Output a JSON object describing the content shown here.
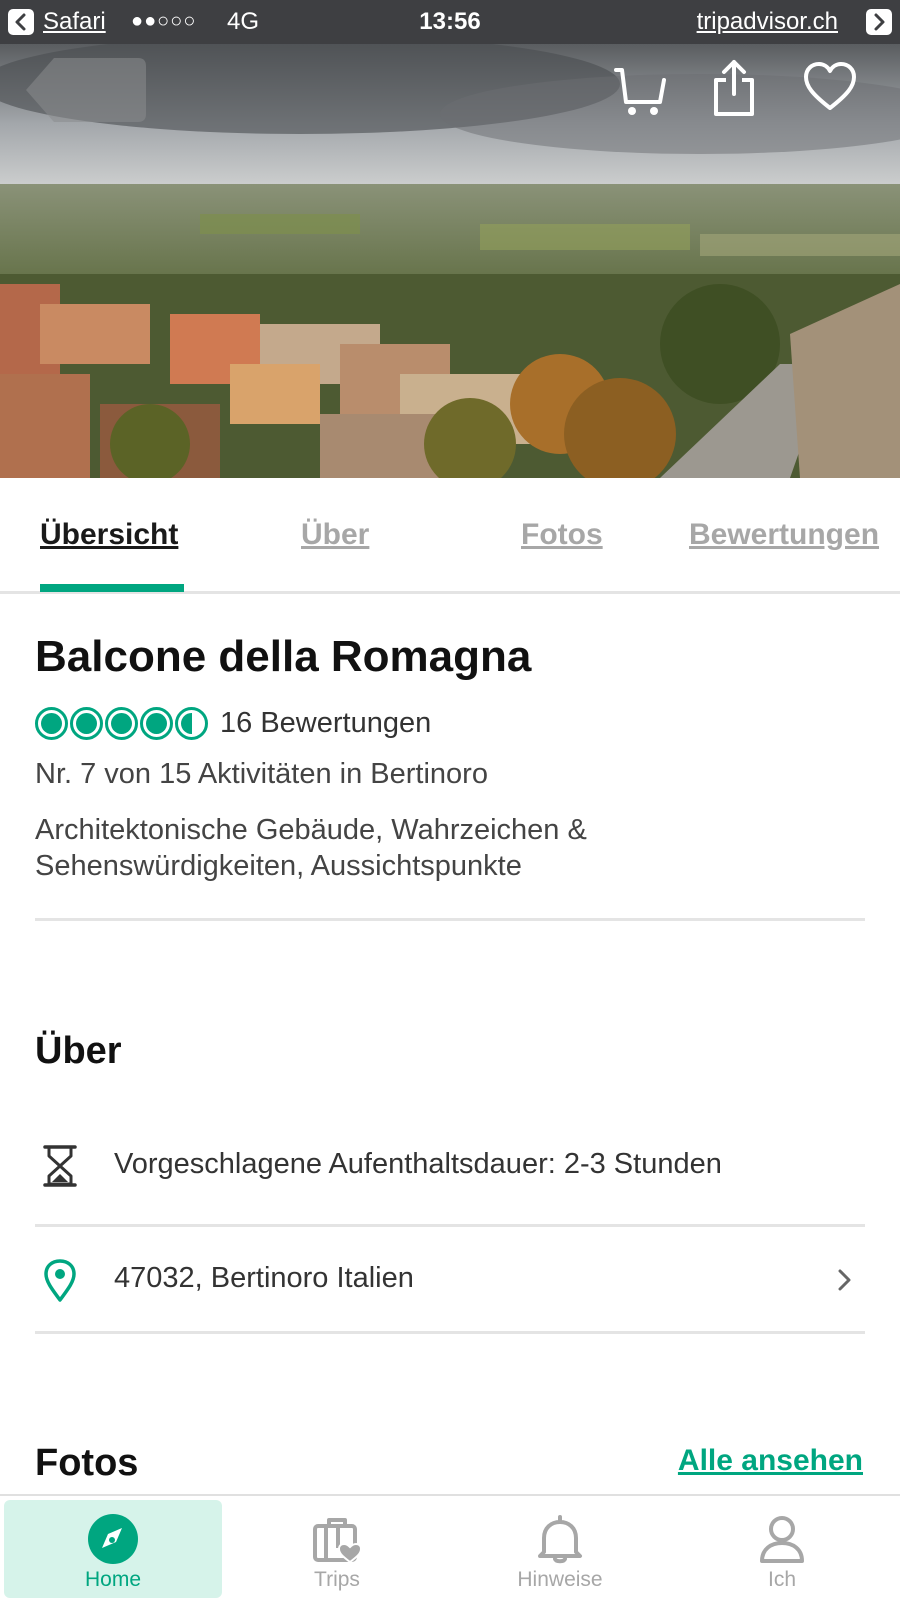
{
  "status_bar": {
    "app": "Safari",
    "signal": "●●○○○",
    "network": "4G",
    "time": "13:56",
    "url": "tripadvisor.ch"
  },
  "hero": {
    "icons": [
      "back-icon",
      "cart-icon",
      "share-icon",
      "heart-icon"
    ]
  },
  "tabs": [
    {
      "label": "Übersicht",
      "active": true
    },
    {
      "label": "Über",
      "active": false
    },
    {
      "label": "Fotos",
      "active": false
    },
    {
      "label": "Bewertungen",
      "active": false
    }
  ],
  "attraction": {
    "name": "Balcone della Romagna",
    "rating": 4.5,
    "rating_max": 5,
    "review_count": "16 Bewertungen",
    "ranking": "Nr. 7 von 15 Aktivitäten in Bertinoro",
    "categories": "Architektonische Gebäude, Wahrzeichen & Sehenswürdigkeiten, Aussichtspunkte"
  },
  "about": {
    "heading": "Über",
    "duration": "Vorgeschlagene Aufenthaltsdauer: 2-3 Stunden",
    "address": "47032, Bertinoro Italien"
  },
  "photos": {
    "heading": "Fotos",
    "see_all": "Alle ansehen"
  },
  "bottom_nav": [
    {
      "label": "Home",
      "icon": "compass-icon",
      "active": true
    },
    {
      "label": "Trips",
      "icon": "suitcase-heart-icon",
      "active": false
    },
    {
      "label": "Hinweise",
      "icon": "bell-icon",
      "active": false
    },
    {
      "label": "Ich",
      "icon": "person-icon",
      "active": false
    }
  ],
  "colors": {
    "accent": "#00a680",
    "status_bar": "#3e3f42",
    "nav_active_bg": "#d6f3ea"
  }
}
